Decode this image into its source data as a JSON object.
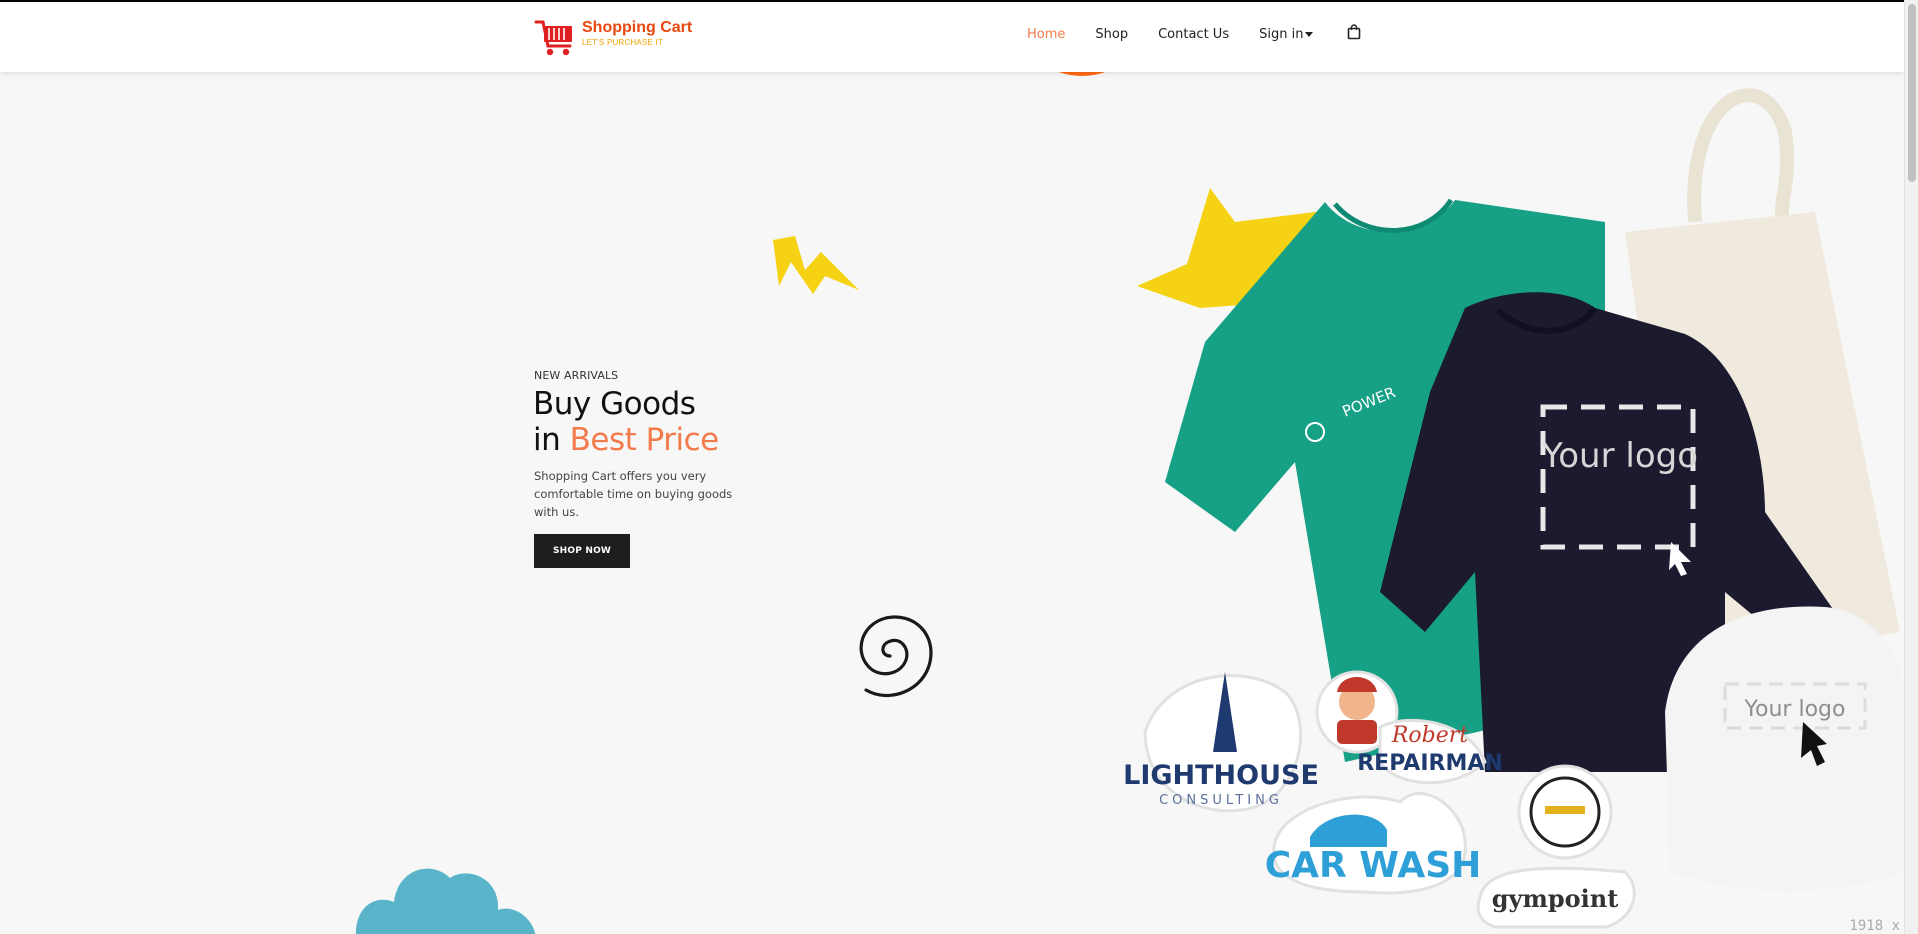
{
  "brand": {
    "name": "Shopping Cart",
    "tagline": "LET'S PURCHASE IT",
    "color": "#e8470f",
    "tagline_color": "#f2a200"
  },
  "nav": {
    "items": [
      {
        "label": "Home",
        "active": true
      },
      {
        "label": "Shop",
        "active": false
      },
      {
        "label": "Contact Us",
        "active": false
      },
      {
        "label": "Sign in",
        "active": false,
        "dropdown": true
      }
    ],
    "cart_icon": "shopping-bag-icon",
    "active_color": "#f37a4a"
  },
  "hero": {
    "eyebrow": "NEW ARRIVALS",
    "headline_line1": "Buy Goods",
    "headline_line2_prefix": "in",
    "headline_accent": "Best Price",
    "description": "Shopping Cart offers you very comfortable time on buying goods with us.",
    "cta_label": "SHOP NOW",
    "accent_color": "#f37a4a"
  },
  "products_image": {
    "tshirt_text": "POWER",
    "sweater_text": "Your logo",
    "cap_text": "Your logo",
    "stickers": [
      "LIGHTHOUSE",
      "CONSULTING",
      "Robert",
      "REPAIRMAN",
      "CAR WASH",
      "gympoint"
    ]
  },
  "watermark": "1918 x"
}
